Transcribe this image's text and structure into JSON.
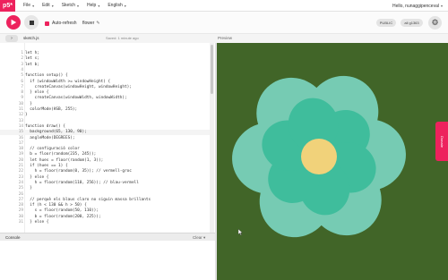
{
  "menubar": {
    "logo": "p5*",
    "items": [
      {
        "label": "File"
      },
      {
        "label": "Edit"
      },
      {
        "label": "Sketch"
      },
      {
        "label": "Help"
      },
      {
        "label": "English"
      }
    ],
    "user": "Hello, nunaggipenceval"
  },
  "toolbar": {
    "auto_refresh_label": "Auto-refresh",
    "sketch_name": "flower",
    "public_label": "PUBLIC",
    "sketch_id": "all g1363"
  },
  "subbar": {
    "file_tab": "sketch.js",
    "saved": "Saved: 1 minute ago",
    "preview_label": "Preview"
  },
  "editor": {
    "lines": [
      {
        "n": "1",
        "code": "let h;"
      },
      {
        "n": "2",
        "code": "let s;"
      },
      {
        "n": "3",
        "code": "let b;"
      },
      {
        "n": "4",
        "code": ""
      },
      {
        "n": "5",
        "code": "function setup() {"
      },
      {
        "n": "6",
        "code": "  if (windowWidth >= windowHeight) {"
      },
      {
        "n": "7",
        "code": "    createCanvas(windowHeight, windowHeight);"
      },
      {
        "n": "8",
        "code": "  } else {"
      },
      {
        "n": "9",
        "code": "    createCanvas(windowWidth, windowWidth);"
      },
      {
        "n": "10",
        "code": "  }"
      },
      {
        "n": "11",
        "code": "  colorMode(HSB, 255);"
      },
      {
        "n": "12",
        "code": "}"
      },
      {
        "n": "13",
        "code": ""
      },
      {
        "n": "14",
        "code": "function draw() {"
      },
      {
        "n": "15",
        "code": "  background(65, 130, 90);"
      },
      {
        "n": "16",
        "code": "  angleMode(DEGREES);"
      },
      {
        "n": "17",
        "code": ""
      },
      {
        "n": "18",
        "code": "  // configuració color"
      },
      {
        "n": "19",
        "code": "  b = floor(random(235, 245));"
      },
      {
        "n": "20",
        "code": "  let hues = floor(random(1, 3));"
      },
      {
        "n": "21",
        "code": "  if (hues == 1) {"
      },
      {
        "n": "22",
        "code": "    h = floor(random(0, 35)); // vermell-groc"
      },
      {
        "n": "23",
        "code": "  } else {"
      },
      {
        "n": "24",
        "code": "    h = floor(random(110, 256)); // blau-vermell"
      },
      {
        "n": "25",
        "code": "  }"
      },
      {
        "n": "26",
        "code": ""
      },
      {
        "n": "27",
        "code": "  // perquè els blaus claro no siguin massa brillants"
      },
      {
        "n": "28",
        "code": "  if (h < 130 && h > 50) {"
      },
      {
        "n": "29",
        "code": "    s = floor(random(50, 110));"
      },
      {
        "n": "30",
        "code": "    b = floor(random(200, 225));"
      },
      {
        "n": "31",
        "code": "  } else {"
      }
    ]
  },
  "console": {
    "title": "Console",
    "clear": "Clear"
  },
  "feedback_label": "Donate",
  "colors": {
    "accent": "#ed225d",
    "preview_bg": "#416528",
    "petal_outer": "#76cbb3",
    "petal_inner": "#3fbd9c",
    "center": "#f1d27a"
  }
}
